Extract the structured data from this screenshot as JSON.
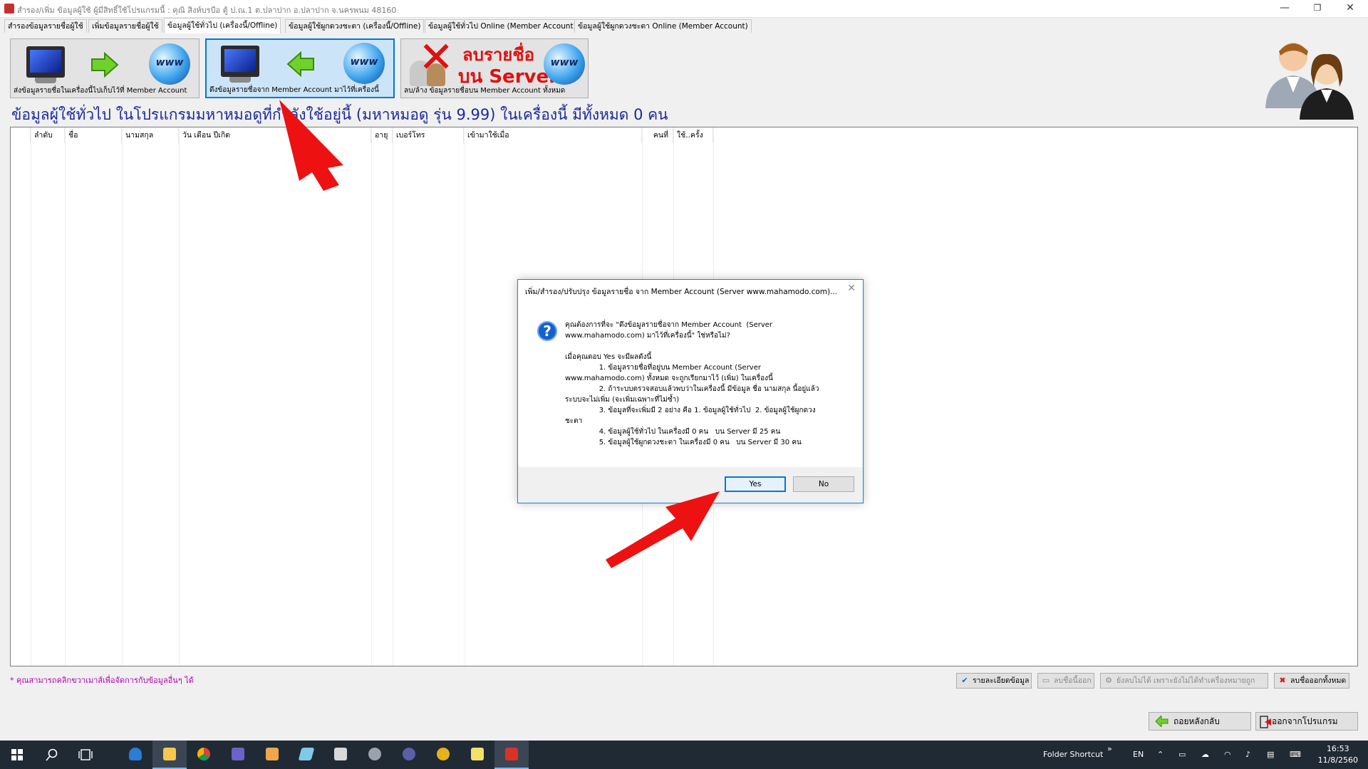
{
  "window": {
    "title": "สำรอง/เพิ่ม ข้อมูลผู้ใช้ ผู้มีสิทธิ์ใช้โปรแกรมนี้ : คุณิ  สิงห์บรบือ     ตู้ ป.ณ.1 ต.ปลาปาก อ.ปลาปาก จ.นครพนม 48160",
    "minimize": "—",
    "restore": "❐",
    "close": "✕"
  },
  "tabs": [
    {
      "label": "สำรองข้อมูลรายชื่อผู้ใช้"
    },
    {
      "label": "เพิ่มข้อมูลรายชื่อผู้ใช้"
    },
    {
      "label": "ข้อมูลผู้ใช้ทั่วไป (เครื่องนี้/Offline)"
    },
    {
      "label": "ข้อมูลผู้ใช้ผูกดวงชะตา (เครื่องนี้/Offline)"
    },
    {
      "label": "ข้อมูลผู้ใช้ทั่วไป Online (Member Account)"
    },
    {
      "label": "ข้อมูลผู้ใช้ผูกดวงชะตา Online (Member Account)"
    }
  ],
  "toolbar": {
    "upload_label": "ส่งข้อมูลรายชื่อในเครื่องนี้ไปเก็บไว้ที่ Member Account",
    "download_label": "ดึงข้อมูลรายชื่อจาก Member Account มาไว้ที่เครื่องนี้",
    "delete_label": "ลบ/ล้าง ข้อมูลรายชื่อบน Member Account ทั้งหมด",
    "delete_line1": "ลบรายชื่อ",
    "delete_line2": "บน Server",
    "www": "www"
  },
  "heading": "ข้อมูลผู้ใช้ทั่วไป ในโปรแกรมมหาหมอดูที่กำลังใช้อยู่นี้ (มหาหมอดู รุ่น 9.99) ในเครื่องนี้ มีทั้งหมด 0 คน",
  "table": {
    "columns": [
      "ลำดับ",
      "ชื่อ",
      "นามสกุล",
      "วัน เดือน ปีเกิด",
      "อายุ",
      "เบอร์โทร",
      "เข้ามาใช้เมื่อ",
      "คนที่",
      "ใช้..ครั้ง"
    ],
    "rows": []
  },
  "footer": {
    "note": "* คุณสามารถคลิกขวาเมาส์เพื่อจัดการกับข้อมูลอื่นๆ ได้",
    "details_btn": "รายละเอียดข้อมูล",
    "delete_btn": "ลบชื่อนี้ออก",
    "disabled_btn": "ยังลบไม่ได้ เพราะยังไม่ได้ทำเครื่องหมายถูก",
    "delete_all_btn": "ลบชื่อออกทั้งหมด"
  },
  "nav": {
    "back": "ถอยหลังกลับ",
    "exit": "ออกจากโปรแกรม"
  },
  "dialog": {
    "title": "เพิ่ม/สำรอง/ปรับปรุง ข้อมูลรายชื่อ จาก Member Account (Server www.mahamodo.com)...",
    "close": "✕",
    "message": "คุณต้องการที่จะ \"ดึงข้อมูลรายชื่อจาก Member Account  (Server\nwww.mahamodo.com) มาไว้ที่เครื่องนี้\" ใช่หรือไม่?\n\nเมื่อคุณตอบ Yes จะมีผลดังนี้\n               1. ข้อมูลรายชื่อที่อยู่บน Member Account (Server\nwww.mahamodo.com) ทั้งหมด จะถูกเรียกมาไว้ (เพิ่ม) ในเครื่องนี้\n               2. ถ้าระบบตรวจสอบแล้วพบว่าในเครื่องนี้ มีข้อมูล ชื่อ นามสกุล นี้อยู่แล้ว\nระบบจะไม่เพิ่ม (จะเพิ่มเฉพาะที่ไม่ซ้ำ)\n               3. ข้อมูลที่จะเพิ่มมี 2 อย่าง คือ 1. ข้อมูลผู้ใช้ทั่วไป  2. ข้อมูลผู้ใช้ผูกดวง\nชะตา\n               4. ข้อมูลผู้ใช้ทั่วไป ในเครื่องมี 0 คน   บน Server มี 25 คน\n               5. ข้อมูลผู้ใช้ผูกดวงชะตา ในเครื่องมี 0 คน   บน Server มี 30 คน",
    "yes": "Yes",
    "no": "No",
    "icon": "?"
  },
  "taskbar": {
    "folder_shortcut": "Folder Shortcut",
    "chevron": "»",
    "lang": "EN",
    "time": "16:53",
    "date": "11/8/2560"
  },
  "colors": {
    "accent": "#0078d7",
    "heading": "#1b2a9e",
    "note": "#b000b0",
    "arrow": "#ee1111",
    "taskbar": "#202a35"
  }
}
